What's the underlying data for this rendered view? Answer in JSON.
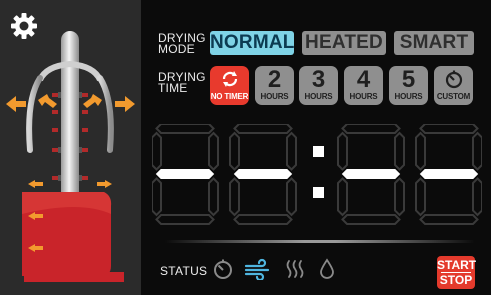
{
  "settings": {
    "icon": "gear-icon"
  },
  "drying_mode": {
    "label_line1": "DRYING",
    "label_line2": "MODE",
    "options": [
      "NORMAL",
      "HEATED",
      "SMART"
    ],
    "selected": "NORMAL"
  },
  "drying_time": {
    "label_line1": "DRYING",
    "label_line2": "TIME",
    "options": [
      {
        "num": "",
        "sub": "NO TIMER",
        "icon": "refresh-icon"
      },
      {
        "num": "2",
        "sub": "HOURS"
      },
      {
        "num": "3",
        "sub": "HOURS"
      },
      {
        "num": "4",
        "sub": "HOURS"
      },
      {
        "num": "5",
        "sub": "HOURS"
      },
      {
        "num": "",
        "sub": "CUSTOM",
        "icon": "timer-icon"
      }
    ],
    "selected": "NO TIMER"
  },
  "display": {
    "text": "--:--"
  },
  "status": {
    "label": "STATUS",
    "icons": [
      "timer-icon",
      "wind-icon",
      "heat-icon",
      "drop-icon"
    ],
    "active": "wind-icon"
  },
  "start_stop": {
    "line1": "START",
    "line2": "STOP"
  },
  "colors": {
    "accent": "#7fd3e6",
    "active_red": "#e83a2d",
    "inactive_button": "#8f8f8f",
    "segment_off": "#3a3a3a",
    "segment_on": "#ffffff",
    "dryer_red": "#c9242a",
    "airflow_orange": "#f29a2e"
  }
}
